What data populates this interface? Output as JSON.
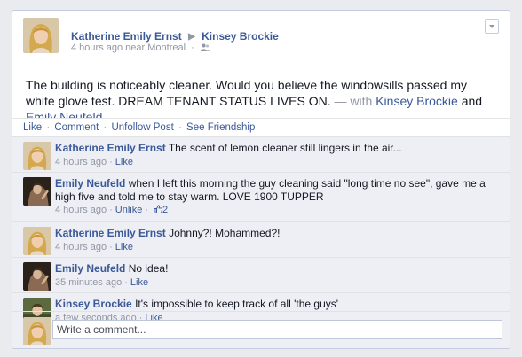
{
  "post": {
    "author": "Katherine Emily Ernst",
    "target": "Kinsey Brockie",
    "time": "4 hours ago",
    "location_prefix": "near",
    "location": "Montreal",
    "dot": "·",
    "body": "The building is noticeably cleaner. Would you believe the windowsills passed my white glove test. DREAM TENANT STATUS LIVES ON.",
    "with_text": "— with",
    "tag1": "Kinsey Brockie",
    "and_text": "and",
    "tag2": "Emily Neufeld",
    "tail": "."
  },
  "actions": {
    "like": "Like",
    "comment": "Comment",
    "unfollow": "Unfollow Post",
    "friendship": "See Friendship",
    "sep": "·"
  },
  "comments": [
    {
      "author": "Katherine Emily Ernst",
      "text": "The scent of lemon cleaner still lingers in the air...",
      "time": "4 hours ago",
      "action": "Like"
    },
    {
      "author": "Emily Neufeld",
      "text": "when I left this morning the guy cleaning said \"long time no see\", gave me a high five and told me to stay warm. LOVE 1900 TUPPER",
      "time": "4 hours ago",
      "action": "Unlike",
      "likes": "2"
    },
    {
      "author": "Katherine Emily Ernst",
      "text": "Johnny?! Mohammed?!",
      "time": "4 hours ago",
      "action": "Like"
    },
    {
      "author": "Emily Neufeld",
      "text": "No idea!",
      "time": "35 minutes ago",
      "action": "Like"
    },
    {
      "author": "Kinsey Brockie",
      "text": "It's impossible to keep track of all 'the guys'",
      "time": "a few seconds ago",
      "action": "Like"
    }
  ],
  "reply": {
    "placeholder": "Write a comment..."
  },
  "colors": {
    "link": "#3b5998",
    "meta": "#9197a3",
    "comment_bg": "#edeff4"
  },
  "icons": {
    "menu": "chevron-down-icon",
    "audience": "friends-icon",
    "like": "thumbs-up-icon"
  }
}
